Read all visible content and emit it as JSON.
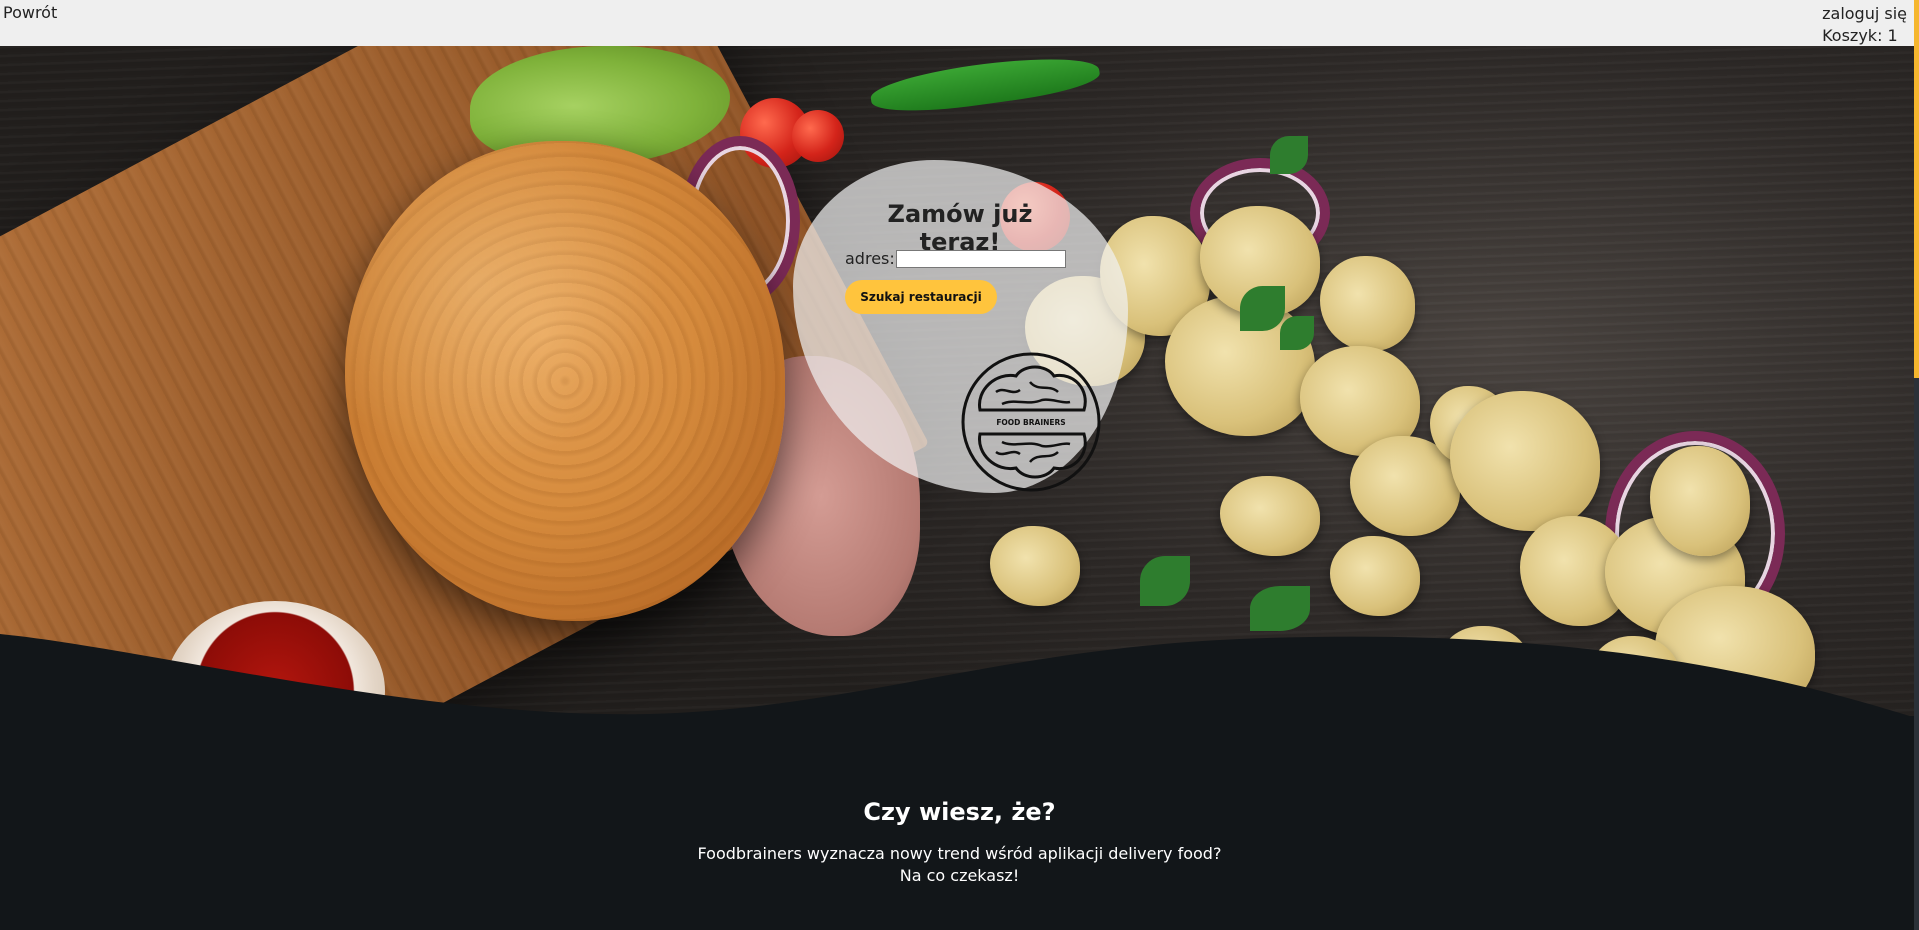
{
  "topbar": {
    "back_label": "Powrót",
    "login_label": "zaloguj się",
    "cart_label": "Koszyk: 1"
  },
  "order_form": {
    "title": "Zamów już teraz!",
    "address_label": "adres:",
    "address_value": "",
    "search_button_label": "Szukaj restauracji"
  },
  "logo": {
    "icon": "brain-icon",
    "text": "FOOD BRAINERS"
  },
  "info": {
    "title": "Czy wiesz, że?",
    "line1": "Foodbrainers wyznacza nowy trend wśród aplikacji delivery food?",
    "line2": "Na co czekasz!"
  },
  "colors": {
    "accent": "#ffc43d",
    "topbar_bg": "#efefef",
    "dark_bg": "#121619",
    "scroll_accent": "#f5b62e"
  }
}
